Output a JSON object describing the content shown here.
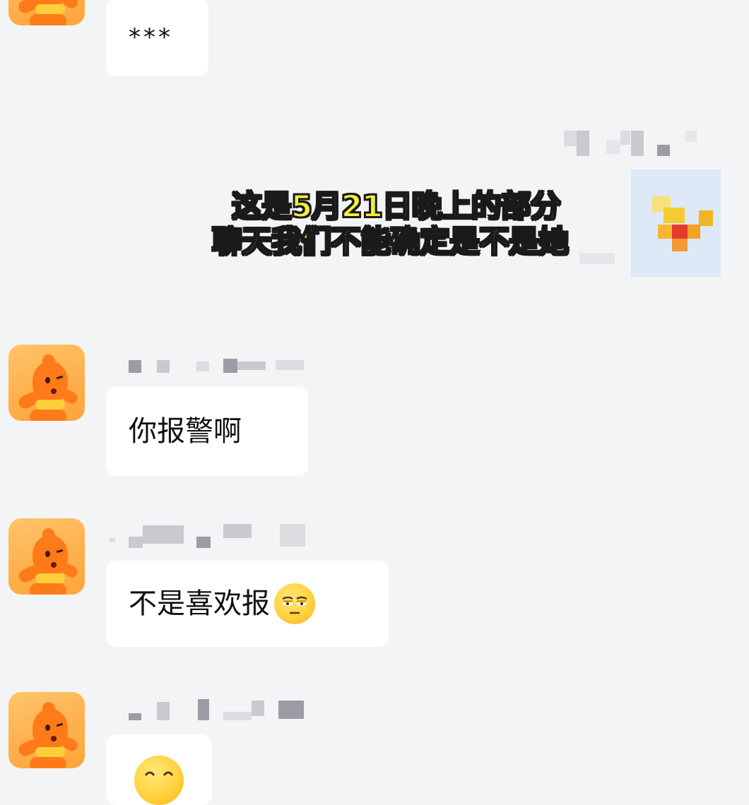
{
  "messages": [
    {
      "side": "left",
      "text": "***"
    },
    {
      "side": "right",
      "text": ""
    },
    {
      "side": "left",
      "text": "你报警啊"
    },
    {
      "side": "left",
      "text": "不是喜欢报",
      "emoji": "unamused-face-icon"
    },
    {
      "side": "left",
      "text": "",
      "emoji": "smiling-face-icon"
    }
  ],
  "caption": {
    "line1": "这是5月21日晚上的部分",
    "line2": "聊天我们不能确定是不是她"
  },
  "colors": {
    "background": "#f3f4f6",
    "bubble": "#ffffff",
    "caption_fill": "#f4ef3a",
    "caption_stroke": "#1a1a1a",
    "avatar": "#ffb04d"
  }
}
